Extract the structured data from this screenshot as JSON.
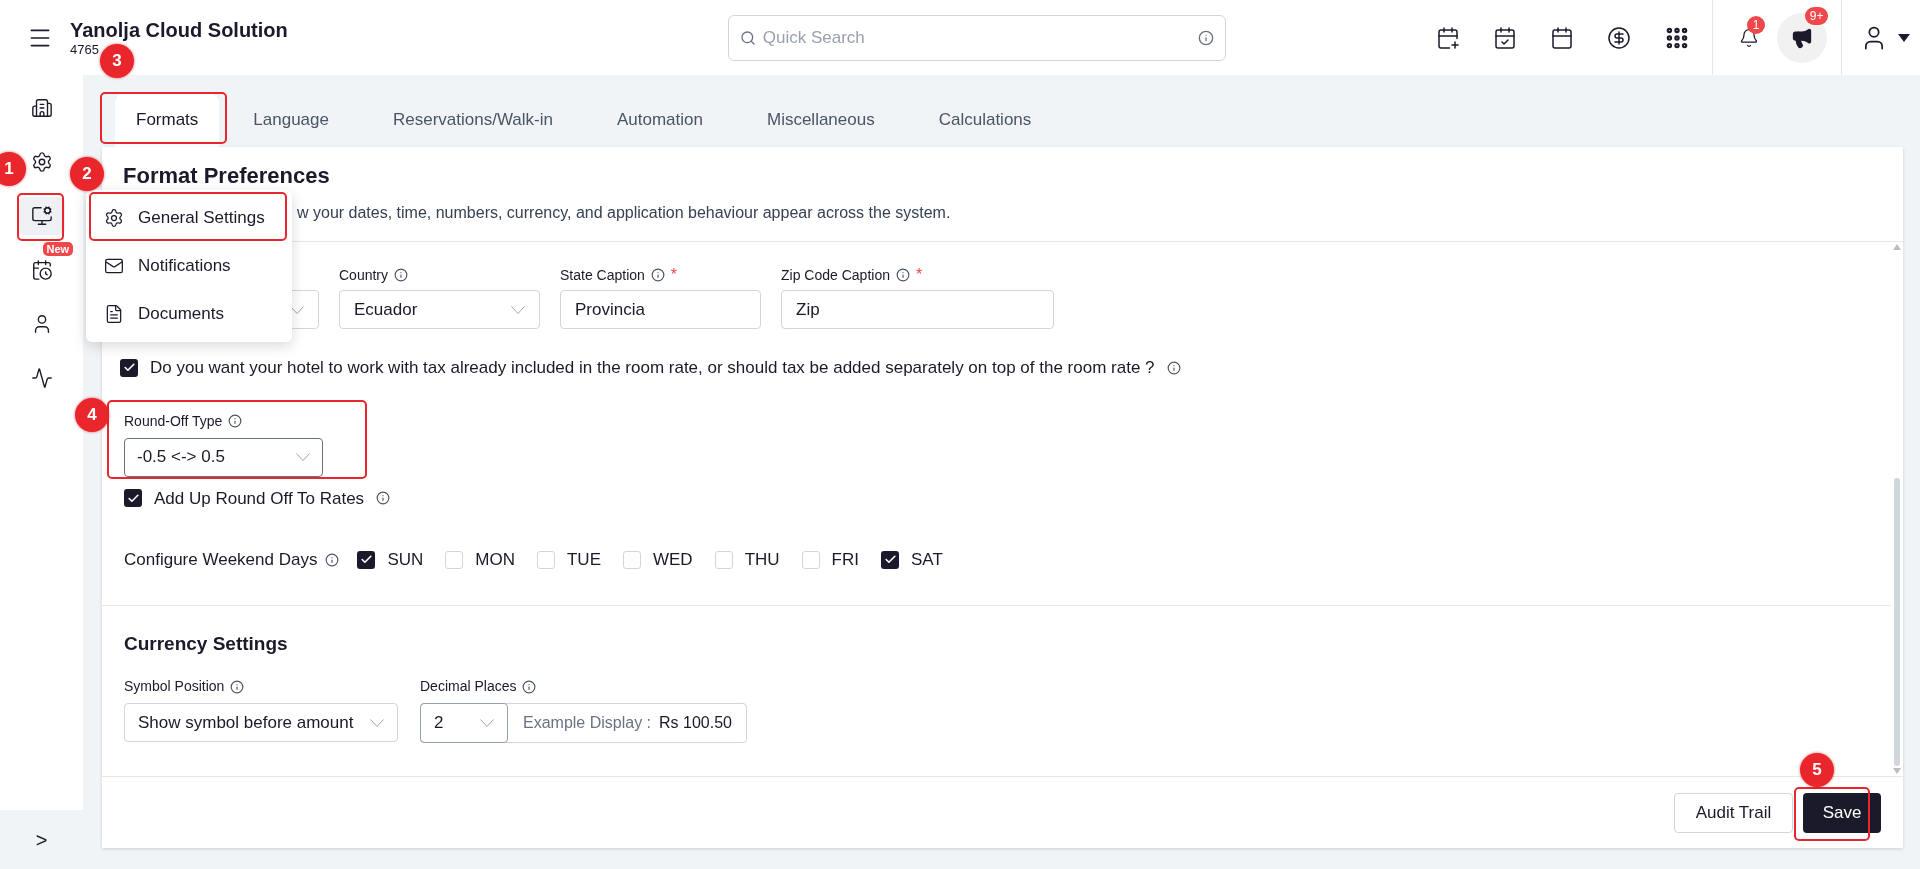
{
  "app": {
    "title": "Yanolja Cloud Solution",
    "code": "4765"
  },
  "search": {
    "placeholder": "Quick Search"
  },
  "header": {
    "bell_badge": "1",
    "announcement_badge": "9+"
  },
  "sidebar": {
    "items": [
      {
        "kind": "building",
        "selected": false
      },
      {
        "kind": "settings",
        "selected": false
      },
      {
        "kind": "monitor",
        "selected": true
      },
      {
        "kind": "calendar",
        "selected": false,
        "badge": "New"
      },
      {
        "kind": "user",
        "selected": false
      },
      {
        "kind": "pulse",
        "selected": false
      }
    ],
    "expand": ">"
  },
  "tabs": [
    {
      "label": "Formats",
      "selected": true
    },
    {
      "label": "Language",
      "selected": false
    },
    {
      "label": "Reservations/Walk-in",
      "selected": false
    },
    {
      "label": "Automation",
      "selected": false
    },
    {
      "label": "Miscellaneous",
      "selected": false
    },
    {
      "label": "Calculations",
      "selected": false
    }
  ],
  "menu": [
    {
      "kind": "settings",
      "label": "General Settings"
    },
    {
      "kind": "mail",
      "label": "Notifications"
    },
    {
      "kind": "file",
      "label": "Documents"
    }
  ],
  "page": {
    "title": "Format Preferences",
    "subtitle": "w your dates, time, numbers, currency, and application behaviour appear across the system."
  },
  "fields": [
    {
      "kind": "select"
    },
    {
      "kind": "select",
      "label": "Country",
      "value": "Ecuador"
    },
    {
      "kind": "text",
      "label": "State Caption",
      "required_mark": "*",
      "value": "Provincia"
    },
    {
      "kind": "text",
      "label": "Zip Code Caption",
      "required_mark": "*",
      "value": "Zip"
    }
  ],
  "tax_question": {
    "checked": true,
    "label": "Do you want your hotel to work with tax already included in the room rate, or should tax be added separately on top of the room rate ?"
  },
  "round_off": {
    "label": "Round-Off Type",
    "value": "-0.5 <-> 0.5"
  },
  "add_up": {
    "checked": true,
    "label": "Add Up Round Off To Rates"
  },
  "weekend": {
    "label": "Configure Weekend Days",
    "days": [
      {
        "label": "SUN",
        "checked": true
      },
      {
        "label": "MON",
        "checked": false
      },
      {
        "label": "TUE",
        "checked": false
      },
      {
        "label": "WED",
        "checked": false
      },
      {
        "label": "THU",
        "checked": false
      },
      {
        "label": "FRI",
        "checked": false
      },
      {
        "label": "SAT",
        "checked": true
      }
    ]
  },
  "currency": {
    "title": "Currency Settings",
    "symbol_position": {
      "label": "Symbol Position",
      "value": "Show symbol before amount"
    },
    "decimal_places": {
      "label": "Decimal Places",
      "value": "2"
    },
    "example": {
      "label": "Example Display :",
      "value": "Rs 100.50"
    }
  },
  "buttons": {
    "audit": "Audit Trail",
    "save": "Save"
  },
  "callouts": [
    "1",
    "2",
    "3",
    "4",
    "5"
  ]
}
